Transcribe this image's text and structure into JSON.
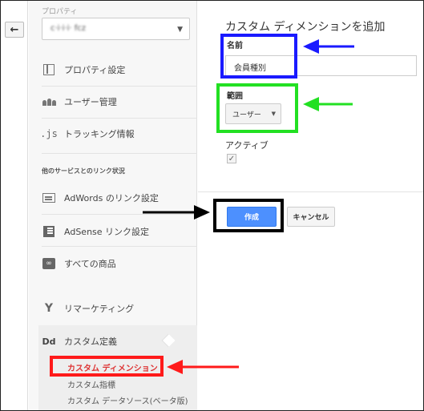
{
  "back_button": {
    "icon": "back-arrow-icon",
    "glyph": "←"
  },
  "sidebar": {
    "property_label": "プロパティ",
    "property_value": "c·i·i·i· fcz",
    "items": [
      {
        "label": "プロパティ設定",
        "icon": "property-settings-icon"
      },
      {
        "label": "ユーザー管理",
        "icon": "users-icon"
      },
      {
        "label": "トラッキング情報",
        "icon": "js-icon",
        "icon_text": ".js"
      },
      {
        "label": "AdWords のリンク設定",
        "icon": "adwords-icon"
      },
      {
        "label": "AdSense リンク設定",
        "icon": "adsense-icon"
      },
      {
        "label": "すべての商品",
        "icon": "link-icon"
      },
      {
        "label": "リマーケティング",
        "icon": "remarketing-icon",
        "icon_text": "Y"
      },
      {
        "label": "カスタム定義",
        "icon": "dd-icon",
        "icon_text": "Dd"
      }
    ],
    "section_label": "他のサービスとのリンク状況",
    "sub_items": [
      {
        "label": "カスタム ディメンション",
        "active": true
      },
      {
        "label": "カスタム指標",
        "active": false
      },
      {
        "label": "カスタム データソース(ベータ版)",
        "active": false
      }
    ]
  },
  "main": {
    "title": "カスタム ディメンションを追加",
    "name_label": "名前",
    "name_value": "会員種別",
    "scope_label": "範囲",
    "scope_value": "ユーザー",
    "active_label": "アクティブ",
    "active_checked": true,
    "create_button": "作成",
    "cancel_button": "キャンセル"
  },
  "annotations": {
    "colors": {
      "blue": "#1a1aff",
      "green": "#22e022",
      "black": "#000000",
      "red": "#ff1a1a"
    }
  }
}
